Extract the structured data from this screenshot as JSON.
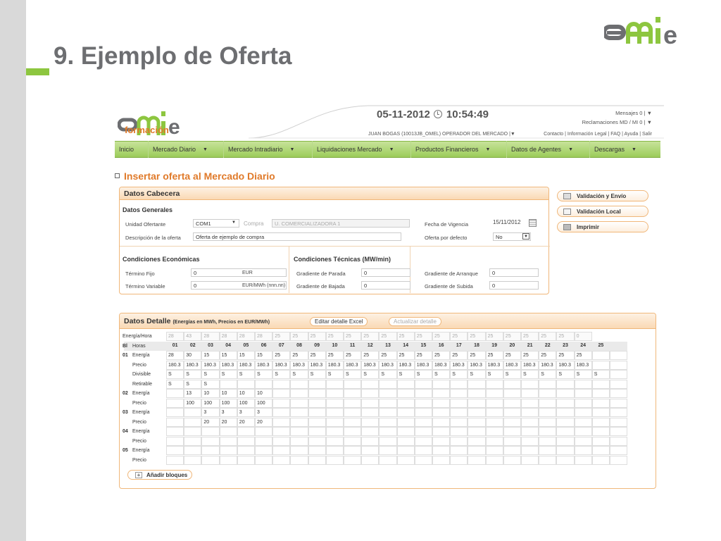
{
  "slide": {
    "title": "9. Ejemplo de Oferta",
    "logo_text": "omie"
  },
  "app": {
    "logo_text": "omie",
    "logo_sub": "formación",
    "date": "05-11-2012",
    "time": "10:54:49",
    "user_line": "JUAN BOGAS (10013JB_OMEL) OPERADOR DEL MERCADO  |▼",
    "messages": "Mensajes   0 | ▼",
    "claims": "Reclamaciones MD / MI   0 | ▼",
    "links": "Contacto  |  Información Legal  |  FAQ  |  Ayuda  |  Salir",
    "nav": [
      {
        "label": "Inicio",
        "arrow": ""
      },
      {
        "label": "Mercado Diario",
        "arrow": "▼"
      },
      {
        "label": "Mercado Intradiario",
        "arrow": "▼"
      },
      {
        "label": "Liquidaciones Mercado",
        "arrow": "▼"
      },
      {
        "label": "Productos Financieros",
        "arrow": "▼"
      },
      {
        "label": "Datos de Agentes",
        "arrow": "▼"
      },
      {
        "label": "Descargas",
        "arrow": "▼"
      }
    ],
    "page_title": "Insertar oferta al Mercado Diario",
    "cabecera": {
      "title": "Datos Cabecera",
      "generales": "Datos Generales",
      "unidad_label": "Unidad Ofertante",
      "unidad_value": "COM1",
      "compra_label": "Compra",
      "company": "U. COMERCIALIZADORA 1",
      "fecha_label": "Fecha de Vigencia",
      "fecha_value": "15/11/2012",
      "desc_label": "Descripción de la oferta",
      "desc_value": "Oferta de ejemplo de compra",
      "defecto_label": "Oferta por defecto",
      "defecto_value": "No",
      "cond_eco": "Condiciones Económicas",
      "termino_fijo_label": "Término Fijo",
      "termino_fijo_value": "0",
      "termino_fijo_unit": "EUR",
      "termino_var_label": "Término Variable",
      "termino_var_value": "0",
      "termino_var_unit": "EUR/MWh (nnn.nn)",
      "cond_tec": "Condiciones Técnicas (MW/min)",
      "parada_label": "Gradiente de Parada",
      "parada_value": "0",
      "bajada_label": "Gradiente de Bajada",
      "bajada_value": "0",
      "arranque_label": "Gradiente de Arranque",
      "arranque_value": "0",
      "subida_label": "Gradiente de Subida",
      "subida_value": "0"
    },
    "actions": {
      "validacion_envio": "Validación y Envío",
      "validacion_local": "Validación Local",
      "imprimir": "Imprimir"
    },
    "detalle": {
      "title": "Datos Detalle",
      "subtitle": "(Energías en MWh, Precios en EUR/MWh)",
      "excel_btn": "Editar detalle Excel",
      "update_btn": "Actualizar detalle",
      "energia_hora_label": "Energía/Hora",
      "energia_hora": [
        "28",
        "43",
        "28",
        "28",
        "28",
        "28",
        "25",
        "25",
        "25",
        "25",
        "25",
        "25",
        "25",
        "25",
        "25",
        "25",
        "25",
        "25",
        "25",
        "25",
        "25",
        "25",
        "25",
        "0"
      ],
      "bl_label": "Bl",
      "horas_label": "Horas",
      "hours": [
        "01",
        "02",
        "03",
        "04",
        "05",
        "06",
        "07",
        "08",
        "09",
        "10",
        "11",
        "12",
        "13",
        "14",
        "15",
        "16",
        "17",
        "18",
        "19",
        "20",
        "21",
        "22",
        "23",
        "24",
        "25"
      ],
      "blocks": [
        {
          "num": "01",
          "rows": [
            {
              "label": "Energía",
              "values": [
                "28",
                "30",
                "15",
                "15",
                "15",
                "15",
                "25",
                "25",
                "25",
                "25",
                "25",
                "25",
                "25",
                "25",
                "25",
                "25",
                "25",
                "25",
                "25",
                "25",
                "25",
                "25",
                "25",
                "25",
                "",
                ""
              ]
            },
            {
              "label": "Precio",
              "values": [
                "180.3",
                "180.3",
                "180.3",
                "180.3",
                "180.3",
                "180.3",
                "180.3",
                "180.3",
                "180.3",
                "180.3",
                "180.3",
                "180.3",
                "180.3",
                "180.3",
                "180.3",
                "180.3",
                "180.3",
                "180.3",
                "180.3",
                "180.3",
                "180.3",
                "180.3",
                "180.3",
                "180.3",
                "",
                ""
              ]
            },
            {
              "label": "Divisible",
              "values": [
                "S",
                "S",
                "S",
                "S",
                "S",
                "S",
                "S",
                "S",
                "S",
                "S",
                "S",
                "S",
                "S",
                "S",
                "S",
                "S",
                "S",
                "S",
                "S",
                "S",
                "S",
                "S",
                "S",
                "S",
                "S",
                ""
              ]
            },
            {
              "label": "Retirable",
              "values": [
                "S",
                "S",
                "S",
                "",
                "",
                "",
                "",
                "",
                "",
                "",
                "",
                "",
                "",
                "",
                "",
                "",
                "",
                "",
                "",
                "",
                "",
                "",
                "",
                "",
                "",
                ""
              ]
            }
          ]
        },
        {
          "num": "02",
          "rows": [
            {
              "label": "Energía",
              "values": [
                "",
                "13",
                "10",
                "10",
                "10",
                "10",
                "",
                "",
                "",
                "",
                "",
                "",
                "",
                "",
                "",
                "",
                "",
                "",
                "",
                "",
                "",
                "",
                "",
                "",
                "",
                ""
              ]
            },
            {
              "label": "Precio",
              "values": [
                "",
                "100",
                "100",
                "100",
                "100",
                "100",
                "",
                "",
                "",
                "",
                "",
                "",
                "",
                "",
                "",
                "",
                "",
                "",
                "",
                "",
                "",
                "",
                "",
                "",
                "",
                ""
              ]
            }
          ]
        },
        {
          "num": "03",
          "rows": [
            {
              "label": "Energía",
              "values": [
                "",
                "",
                "3",
                "3",
                "3",
                "3",
                "",
                "",
                "",
                "",
                "",
                "",
                "",
                "",
                "",
                "",
                "",
                "",
                "",
                "",
                "",
                "",
                "",
                "",
                "",
                ""
              ]
            },
            {
              "label": "Precio",
              "values": [
                "",
                "",
                "20",
                "20",
                "20",
                "20",
                "",
                "",
                "",
                "",
                "",
                "",
                "",
                "",
                "",
                "",
                "",
                "",
                "",
                "",
                "",
                "",
                "",
                "",
                "",
                ""
              ]
            }
          ]
        },
        {
          "num": "04",
          "rows": [
            {
              "label": "Energía",
              "values": [
                "",
                "",
                "",
                "",
                "",
                "",
                "",
                "",
                "",
                "",
                "",
                "",
                "",
                "",
                "",
                "",
                "",
                "",
                "",
                "",
                "",
                "",
                "",
                "",
                "",
                ""
              ]
            },
            {
              "label": "Precio",
              "values": [
                "",
                "",
                "",
                "",
                "",
                "",
                "",
                "",
                "",
                "",
                "",
                "",
                "",
                "",
                "",
                "",
                "",
                "",
                "",
                "",
                "",
                "",
                "",
                "",
                "",
                ""
              ]
            }
          ]
        },
        {
          "num": "05",
          "rows": [
            {
              "label": "Energía",
              "values": [
                "",
                "",
                "",
                "",
                "",
                "",
                "",
                "",
                "",
                "",
                "",
                "",
                "",
                "",
                "",
                "",
                "",
                "",
                "",
                "",
                "",
                "",
                "",
                "",
                "",
                ""
              ]
            },
            {
              "label": "Precio",
              "values": [
                "",
                "",
                "",
                "",
                "",
                "",
                "",
                "",
                "",
                "",
                "",
                "",
                "",
                "",
                "",
                "",
                "",
                "",
                "",
                "",
                "",
                "",
                "",
                "",
                "",
                ""
              ]
            }
          ]
        }
      ],
      "add_blocks": "Añadir bloques"
    }
  }
}
